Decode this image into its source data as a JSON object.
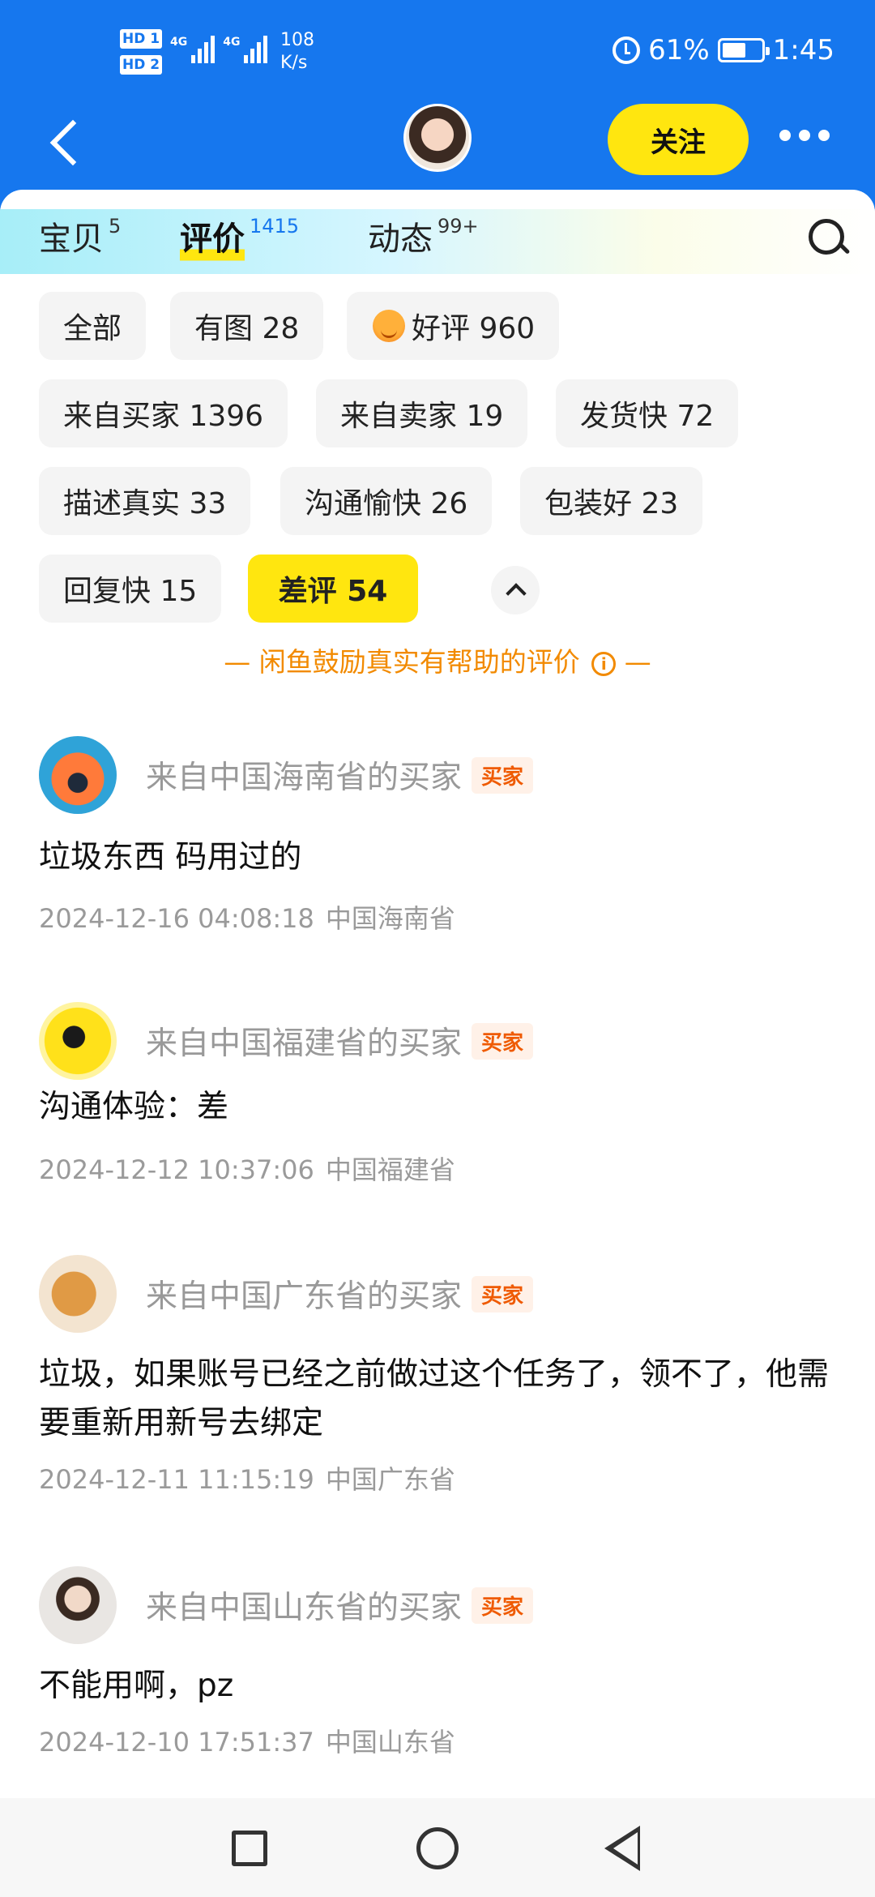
{
  "status_bar": {
    "sim1": "HD 1",
    "sim2": "HD 2",
    "signal1_label": "4G",
    "signal2_label": "4G",
    "net_speed_value": "108",
    "net_speed_unit": "K/s",
    "battery": "61%",
    "battery_level": 0.61,
    "time": "1:45"
  },
  "header": {
    "follow_label": "关注"
  },
  "tabs": [
    {
      "label": "宝贝",
      "count": "5"
    },
    {
      "label": "评价",
      "count": "1415",
      "active": true
    },
    {
      "label": "动态",
      "count": "99+"
    }
  ],
  "filters": [
    {
      "label": "全部"
    },
    {
      "label": "有图 28"
    },
    {
      "label": "好评 960",
      "icon": "smiling-face-icon"
    },
    {
      "label": "来自买家 1396"
    },
    {
      "label": "来自卖家 19"
    },
    {
      "label": "发货快 72"
    },
    {
      "label": "描述真实 33"
    },
    {
      "label": "沟通愉快 26"
    },
    {
      "label": "包装好 23"
    },
    {
      "label": "回复快 15"
    },
    {
      "label": "差评 54",
      "selected": true
    }
  ],
  "encourage_note": "— 闲鱼鼓励真实有帮助的评价",
  "encourage_tail": "—",
  "info_glyph": "i",
  "reviews": [
    {
      "from": "来自中国海南省的买家",
      "badge": "买家",
      "text": "垃圾东西 码用过的",
      "datetime": "2024-12-16 04:08:18",
      "location": "中国海南省"
    },
    {
      "from": "来自中国福建省的买家",
      "badge": "买家",
      "text": "沟通体验：差",
      "datetime": "2024-12-12 10:37:06",
      "location": "中国福建省"
    },
    {
      "from": "来自中国广东省的买家",
      "badge": "买家",
      "text": "垃圾，如果账号已经之前做过这个任务了，领不了，他需要重新用新号去绑定",
      "datetime": "2024-12-11 11:15:19",
      "location": "中国广东省"
    },
    {
      "from": "来自中国山东省的买家",
      "badge": "买家",
      "text": "不能用啊，pz",
      "datetime": "2024-12-10 17:51:37",
      "location": "中国山东省"
    }
  ],
  "colors": {
    "brand_blue": "#1677ee",
    "accent_yellow": "#ffe60f",
    "note_orange": "#f28a00",
    "badge_orange": "#ef5a00"
  }
}
